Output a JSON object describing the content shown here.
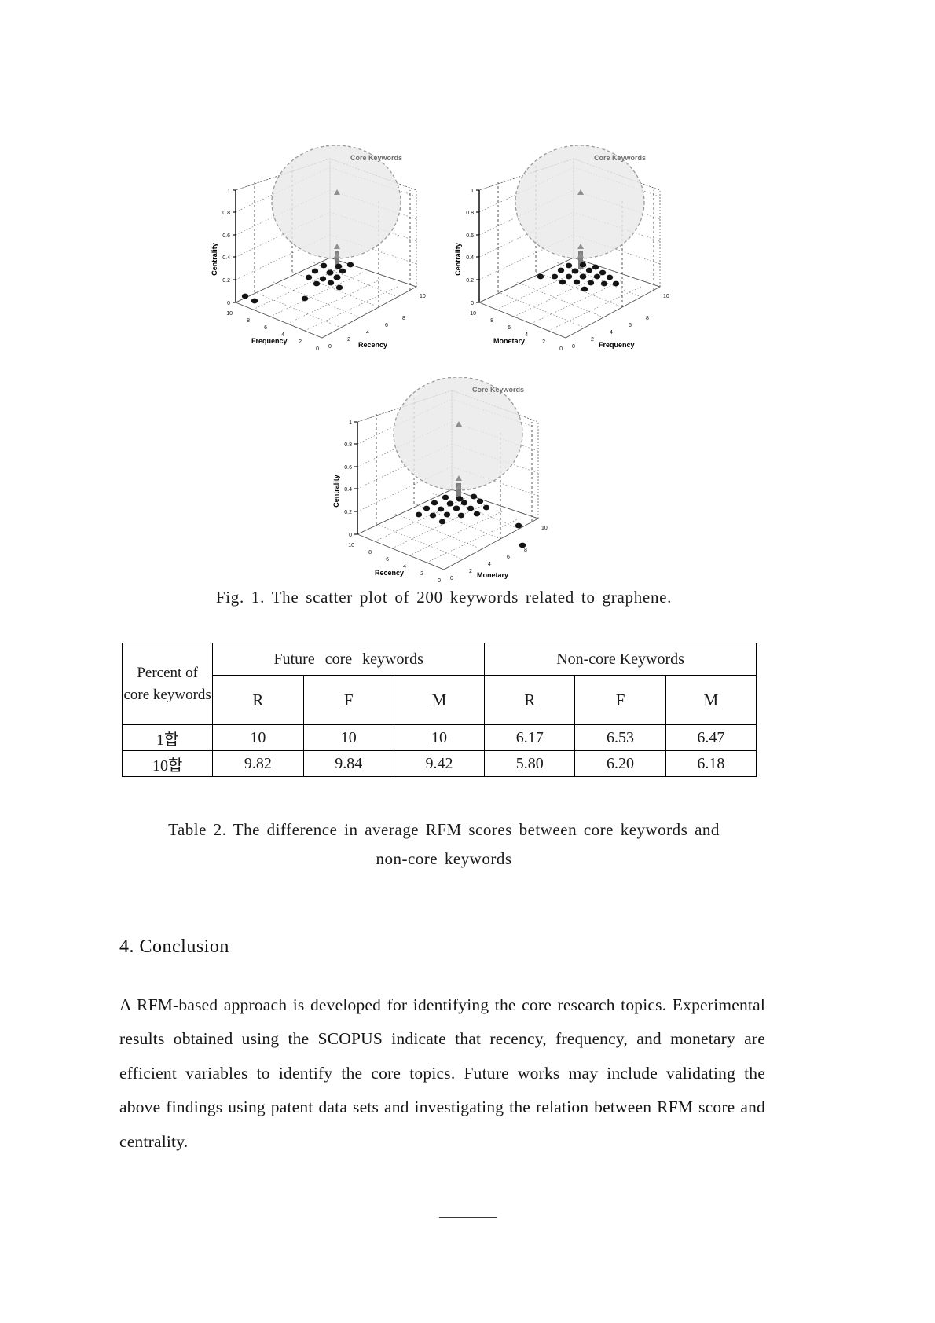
{
  "figure": {
    "caption": "Fig. 1. The scatter plot of 200 keywords related to graphene.",
    "charts": [
      {
        "id": "chart-recency-frequency",
        "zlabel": "Centrality",
        "xlabel": "Frequency",
        "ylabel": "Recency",
        "annotation": "Core Keywords",
        "zticks": [
          "0",
          "0.2",
          "0.4",
          "0.6",
          "0.8",
          "1"
        ],
        "xticks": [
          "10",
          "8",
          "6",
          "4",
          "2",
          "0"
        ],
        "yticks": [
          "0",
          "2",
          "4",
          "6",
          "8",
          "10"
        ]
      },
      {
        "id": "chart-monetary-frequency",
        "zlabel": "Centrality",
        "xlabel": "Monetary",
        "ylabel": "Frequency",
        "annotation": "Core Keywords",
        "zticks": [
          "0",
          "0.2",
          "0.4",
          "0.6",
          "0.8",
          "1"
        ],
        "xticks": [
          "10",
          "8",
          "6",
          "4",
          "2",
          "0"
        ],
        "yticks": [
          "0",
          "2",
          "4",
          "6",
          "8",
          "10"
        ]
      },
      {
        "id": "chart-recency-monetary",
        "zlabel": "Centrality",
        "xlabel": "Recency",
        "ylabel": "Monetary",
        "annotation": "Core Keywords",
        "zticks": [
          "0",
          "0.2",
          "0.4",
          "0.6",
          "0.8",
          "1"
        ],
        "xticks": [
          "10",
          "8",
          "6",
          "4",
          "2",
          "0"
        ],
        "yticks": [
          "0",
          "2",
          "4",
          "6",
          "8",
          "10"
        ]
      }
    ]
  },
  "chart_data": [
    {
      "type": "scatter",
      "title": "The scatter plot of 200 keywords related to graphene.",
      "xlabel": "Frequency",
      "ylabel": "Recency",
      "zlabel": "Centrality",
      "xlim": [
        0,
        10
      ],
      "ylim": [
        0,
        10
      ],
      "zlim": [
        0,
        1
      ],
      "xticks": [
        0,
        2,
        4,
        6,
        8,
        10
      ],
      "yticks": [
        0,
        2,
        4,
        6,
        8,
        10
      ],
      "zticks": [
        0,
        0.2,
        0.4,
        0.6,
        0.8,
        1
      ],
      "grid": true,
      "annotations": [
        "Core Keywords"
      ],
      "series": [
        {
          "name": "Core Keywords",
          "marker": "triangle",
          "color": "#8c8c8c",
          "points": [
            {
              "x": 9.6,
              "y": 9.6,
              "z": 0.92
            },
            {
              "x": 9.6,
              "y": 9.6,
              "z": 0.55
            },
            {
              "x": 9.6,
              "y": 9.6,
              "z": 0.4
            },
            {
              "x": 9.6,
              "y": 9.6,
              "z": 0.36
            }
          ]
        },
        {
          "name": "Non-core Keywords",
          "marker": "circle",
          "color": "#1a1a1a",
          "points": [
            {
              "x": 9.0,
              "y": 9.4,
              "z": 0.3
            },
            {
              "x": 8.2,
              "y": 9.2,
              "z": 0.27
            },
            {
              "x": 9.3,
              "y": 8.8,
              "z": 0.26
            },
            {
              "x": 7.4,
              "y": 8.6,
              "z": 0.24
            },
            {
              "x": 8.6,
              "y": 8.4,
              "z": 0.23
            },
            {
              "x": 6.8,
              "y": 8.2,
              "z": 0.21
            },
            {
              "x": 8.0,
              "y": 8.0,
              "z": 0.21
            },
            {
              "x": 9.1,
              "y": 7.8,
              "z": 0.2
            },
            {
              "x": 7.2,
              "y": 7.6,
              "z": 0.19
            },
            {
              "x": 8.4,
              "y": 7.4,
              "z": 0.18
            },
            {
              "x": 6.4,
              "y": 7.2,
              "z": 0.17
            },
            {
              "x": 7.8,
              "y": 7.0,
              "z": 0.16
            },
            {
              "x": 8.8,
              "y": 6.6,
              "z": 0.15
            },
            {
              "x": 5.0,
              "y": 4.0,
              "z": 0.04
            },
            {
              "x": 1.2,
              "y": 1.0,
              "z": 0.03
            },
            {
              "x": 1.8,
              "y": 0.6,
              "z": 0.02
            }
          ]
        }
      ]
    },
    {
      "type": "scatter",
      "title": "The scatter plot of 200 keywords related to graphene.",
      "xlabel": "Monetary",
      "ylabel": "Frequency",
      "zlabel": "Centrality",
      "xlim": [
        0,
        10
      ],
      "ylim": [
        0,
        10
      ],
      "zlim": [
        0,
        1
      ],
      "xticks": [
        0,
        2,
        4,
        6,
        8,
        10
      ],
      "yticks": [
        0,
        2,
        4,
        6,
        8,
        10
      ],
      "zticks": [
        0,
        0.2,
        0.4,
        0.6,
        0.8,
        1
      ],
      "grid": true,
      "annotations": [
        "Core Keywords"
      ],
      "series": [
        {
          "name": "Core Keywords",
          "marker": "triangle",
          "color": "#8c8c8c",
          "points": [
            {
              "x": 9.6,
              "y": 9.6,
              "z": 0.92
            },
            {
              "x": 9.6,
              "y": 9.6,
              "z": 0.55
            },
            {
              "x": 9.6,
              "y": 9.6,
              "z": 0.4
            },
            {
              "x": 9.6,
              "y": 9.6,
              "z": 0.35
            }
          ]
        },
        {
          "name": "Non-core Keywords",
          "marker": "circle",
          "color": "#1a1a1a",
          "points": [
            {
              "x": 9.2,
              "y": 9.5,
              "z": 0.3
            },
            {
              "x": 8.4,
              "y": 9.3,
              "z": 0.28
            },
            {
              "x": 7.6,
              "y": 9.1,
              "z": 0.27
            },
            {
              "x": 9.4,
              "y": 8.9,
              "z": 0.26
            },
            {
              "x": 6.8,
              "y": 8.7,
              "z": 0.25
            },
            {
              "x": 8.6,
              "y": 8.5,
              "z": 0.24
            },
            {
              "x": 7.8,
              "y": 8.3,
              "z": 0.23
            },
            {
              "x": 9.0,
              "y": 8.1,
              "z": 0.22
            },
            {
              "x": 6.2,
              "y": 7.9,
              "z": 0.21
            },
            {
              "x": 8.2,
              "y": 7.7,
              "z": 0.2
            },
            {
              "x": 7.4,
              "y": 7.5,
              "z": 0.19
            },
            {
              "x": 9.2,
              "y": 7.3,
              "z": 0.18
            },
            {
              "x": 6.6,
              "y": 7.1,
              "z": 0.17
            },
            {
              "x": 8.8,
              "y": 6.9,
              "z": 0.16
            },
            {
              "x": 7.0,
              "y": 6.7,
              "z": 0.15
            },
            {
              "x": 8.0,
              "y": 6.5,
              "z": 0.14
            },
            {
              "x": 9.4,
              "y": 6.3,
              "z": 0.13
            },
            {
              "x": 5.4,
              "y": 6.0,
              "z": 0.12
            },
            {
              "x": 2.0,
              "y": 5.0,
              "z": 0.2
            }
          ]
        }
      ]
    },
    {
      "type": "scatter",
      "title": "The scatter plot of 200 keywords related to graphene.",
      "xlabel": "Recency",
      "ylabel": "Monetary",
      "zlabel": "Centrality",
      "xlim": [
        0,
        10
      ],
      "ylim": [
        0,
        10
      ],
      "zlim": [
        0,
        1
      ],
      "xticks": [
        0,
        2,
        4,
        6,
        8,
        10
      ],
      "yticks": [
        0,
        2,
        4,
        6,
        8,
        10
      ],
      "zticks": [
        0,
        0.2,
        0.4,
        0.6,
        0.8,
        1
      ],
      "grid": true,
      "annotations": [
        "Core Keywords"
      ],
      "series": [
        {
          "name": "Core Keywords",
          "marker": "triangle",
          "color": "#8c8c8c",
          "points": [
            {
              "x": 9.6,
              "y": 9.6,
              "z": 0.92
            },
            {
              "x": 9.6,
              "y": 9.6,
              "z": 0.58
            },
            {
              "x": 9.6,
              "y": 9.6,
              "z": 0.42
            },
            {
              "x": 9.6,
              "y": 9.6,
              "z": 0.34
            }
          ]
        },
        {
          "name": "Non-core Keywords",
          "marker": "circle",
          "color": "#1a1a1a",
          "points": [
            {
              "x": 9.0,
              "y": 9.4,
              "z": 0.3
            },
            {
              "x": 8.2,
              "y": 9.2,
              "z": 0.28
            },
            {
              "x": 7.2,
              "y": 9.0,
              "z": 0.26
            },
            {
              "x": 9.3,
              "y": 8.8,
              "z": 0.25
            },
            {
              "x": 6.4,
              "y": 8.6,
              "z": 0.24
            },
            {
              "x": 8.5,
              "y": 8.4,
              "z": 0.23
            },
            {
              "x": 7.6,
              "y": 8.2,
              "z": 0.22
            },
            {
              "x": 5.6,
              "y": 8.0,
              "z": 0.21
            },
            {
              "x": 8.9,
              "y": 7.8,
              "z": 0.2
            },
            {
              "x": 6.9,
              "y": 7.6,
              "z": 0.19
            },
            {
              "x": 7.9,
              "y": 7.4,
              "z": 0.18
            },
            {
              "x": 5.0,
              "y": 7.2,
              "z": 0.17
            },
            {
              "x": 8.4,
              "y": 7.0,
              "z": 0.16
            },
            {
              "x": 6.2,
              "y": 6.8,
              "z": 0.15
            },
            {
              "x": 7.3,
              "y": 6.6,
              "z": 0.14
            },
            {
              "x": 9.1,
              "y": 6.4,
              "z": 0.13
            },
            {
              "x": 4.4,
              "y": 6.2,
              "z": 0.12
            },
            {
              "x": 8.0,
              "y": 6.0,
              "z": 0.11
            },
            {
              "x": 2.0,
              "y": 3.5,
              "z": 0.16
            },
            {
              "x": 3.0,
              "y": 1.0,
              "z": 0.02
            }
          ]
        }
      ]
    }
  ],
  "table": {
    "caption_line1": "Table 2. The difference in average RFM scores between core keywords and",
    "caption_line2": "non-core keywords",
    "stub_line1": "Percent of",
    "stub_line2": "core keywords",
    "group_headers": [
      "Future    core keywords",
      "Non-core Keywords"
    ],
    "sub_headers": [
      "R",
      "F",
      "M",
      "R",
      "F",
      "M"
    ],
    "rows": [
      {
        "label": "1합",
        "values": [
          "10",
          "10",
          "10",
          "6.17",
          "6.53",
          "6.47"
        ]
      },
      {
        "label": "10합",
        "values": [
          "9.82",
          "9.84",
          "9.42",
          "5.80",
          "6.20",
          "6.18"
        ]
      }
    ]
  },
  "conclusion": {
    "heading": "4. Conclusion",
    "paragraph": "A RFM-based approach is developed for identifying the core research topics. Experimental results obtained using the SCOPUS indicate that recency, frequency, and monetary are efficient variables to identify the core topics. Future works may include validating the above findings using patent data sets and investigating the relation between RFM score and centrality."
  },
  "footer": {
    "mark": "————"
  }
}
